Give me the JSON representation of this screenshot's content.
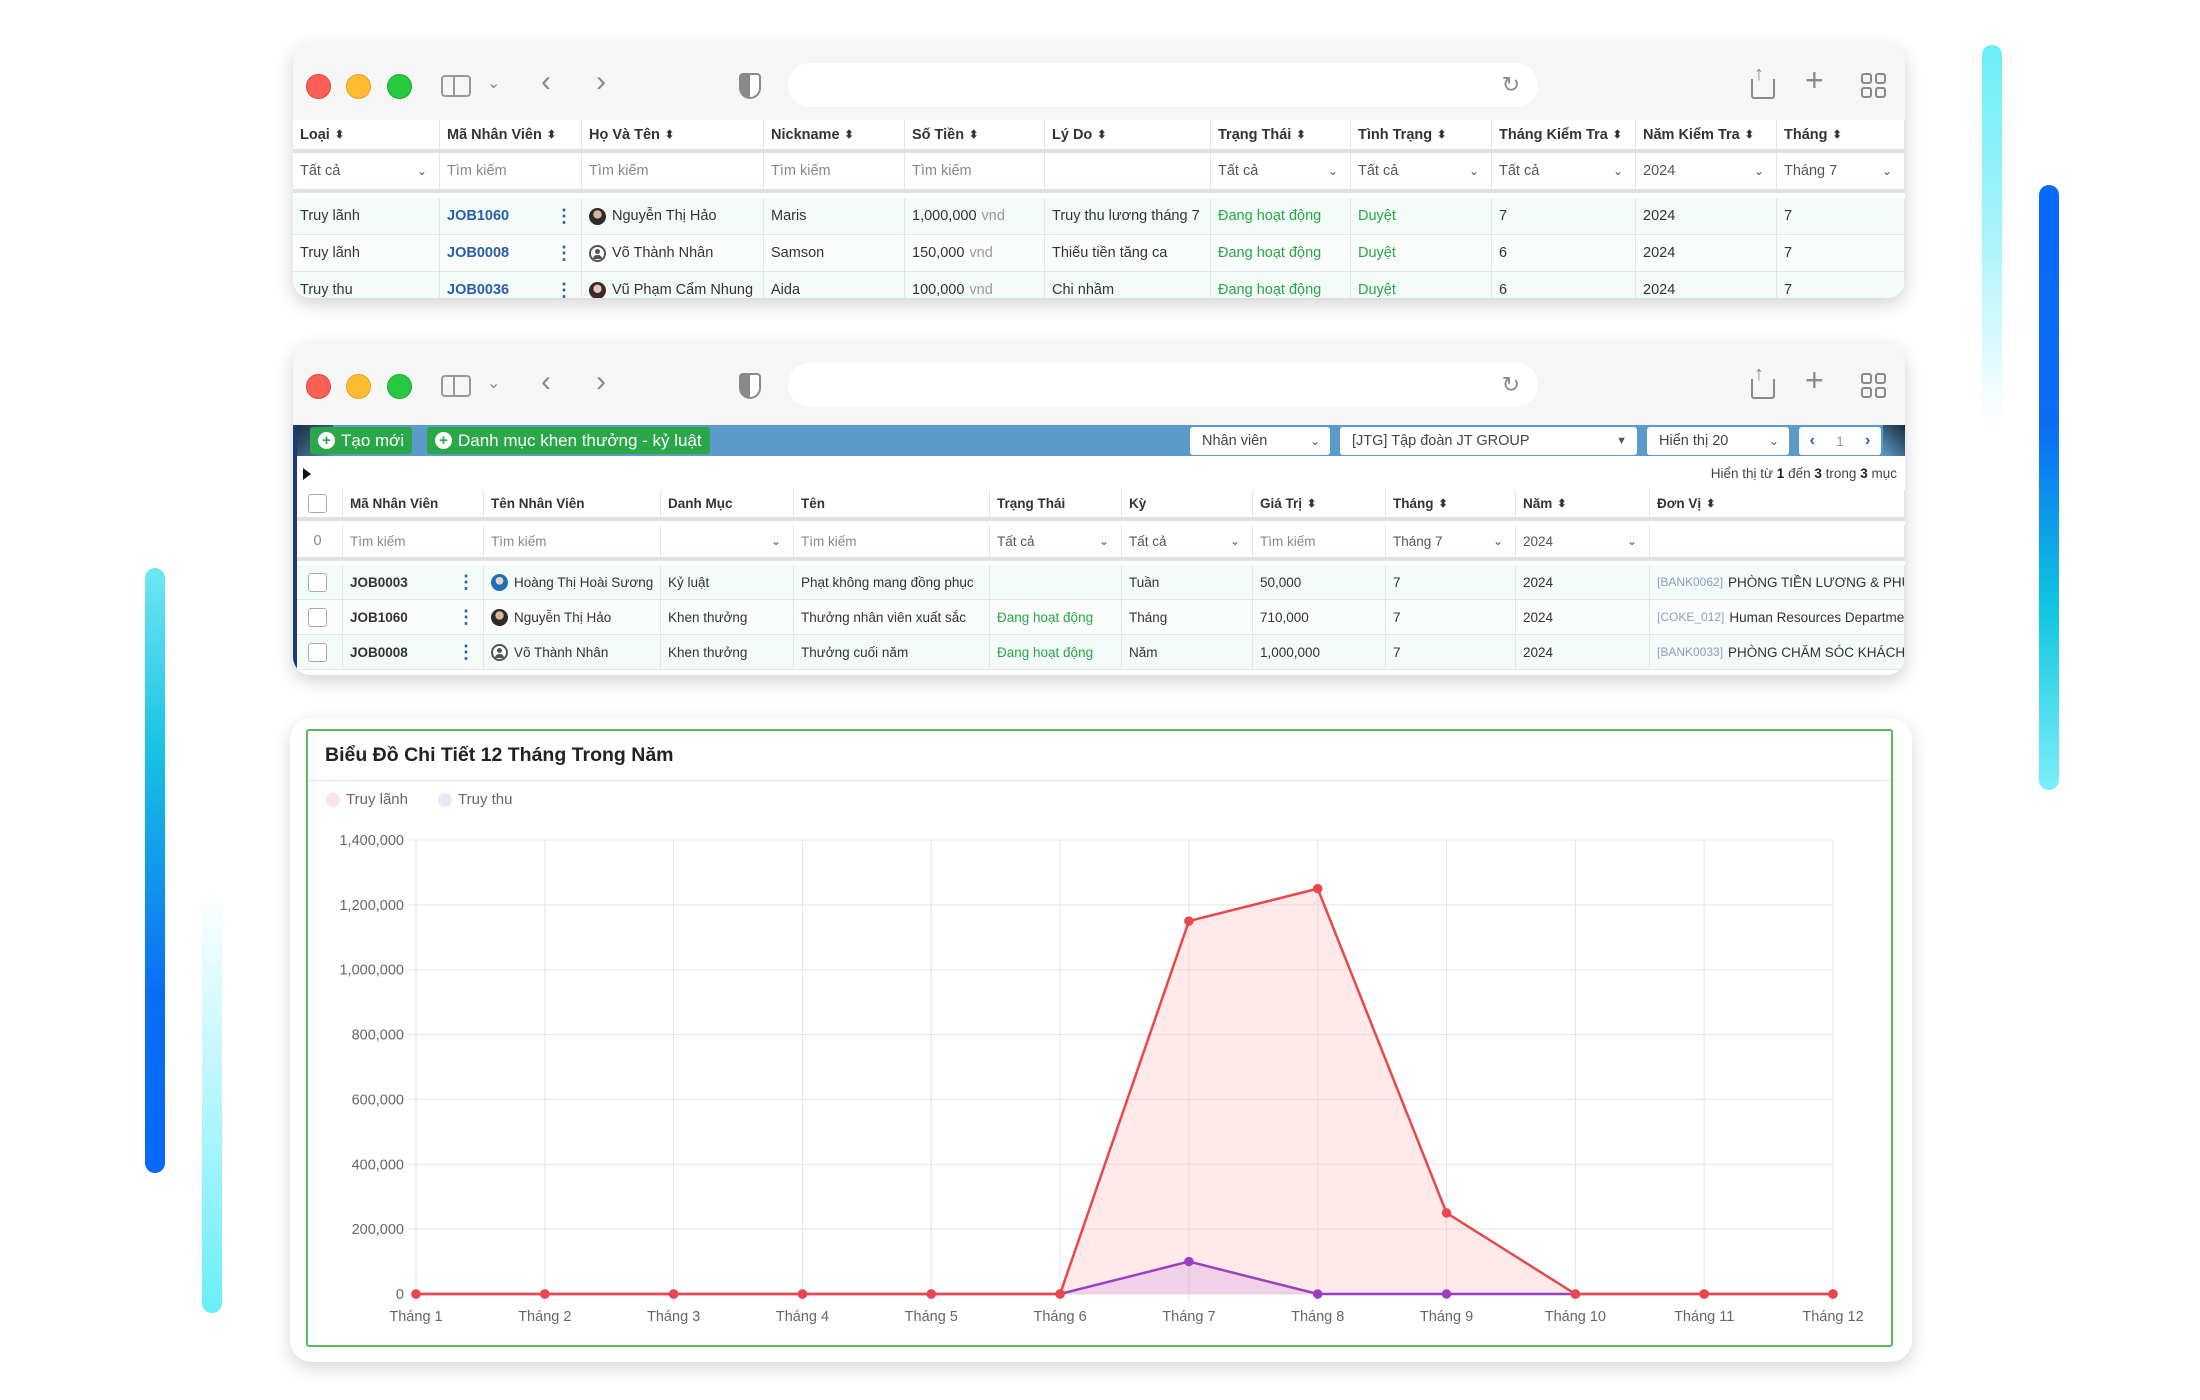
{
  "window1": {
    "columns": [
      {
        "label": "Loại",
        "sortable": true
      },
      {
        "label": "Mã Nhân Viên",
        "sortable": true
      },
      {
        "label": "Họ Và Tên",
        "sortable": true
      },
      {
        "label": "Nickname",
        "sortable": true
      },
      {
        "label": "Số Tiền",
        "sortable": true
      },
      {
        "label": "Lý Do",
        "sortable": true
      },
      {
        "label": "Trạng Thái",
        "sortable": true
      },
      {
        "label": "Tình Trạng",
        "sortable": true
      },
      {
        "label": "Tháng Kiểm Tra",
        "sortable": true
      },
      {
        "label": "Năm Kiểm Tra",
        "sortable": true
      },
      {
        "label": "Tháng",
        "sortable": true
      }
    ],
    "filters": [
      "Tất cả",
      "Tìm kiếm",
      "Tìm kiếm",
      "Tìm kiếm",
      "Tìm kiếm",
      "",
      "Tất cả",
      "Tất cả",
      "Tất cả",
      "2024",
      "Tháng 7"
    ],
    "rows": [
      {
        "type": "Truy lãnh",
        "code": "JOB1060",
        "name": "Nguyễn Thị Hảo",
        "avatar": "photo",
        "nickname": "Maris",
        "amount": "1,000,000",
        "unit": "vnd",
        "reason": "Truy thu lương tháng 7",
        "status": "Đang hoạt động",
        "state": "Duyệt",
        "check_month": "7",
        "check_year": "2024",
        "month": "7"
      },
      {
        "type": "Truy lãnh",
        "code": "JOB0008",
        "name": "Võ Thành Nhân",
        "avatar": "default",
        "nickname": "Samson",
        "amount": "150,000",
        "unit": "vnd",
        "reason": "Thiếu tiền tăng ca",
        "status": "Đang hoạt động",
        "state": "Duyệt",
        "check_month": "6",
        "check_year": "2024",
        "month": "7"
      },
      {
        "type": "Truy thu",
        "code": "JOB0036",
        "name": "Vũ Phạm Cẩm Nhung",
        "avatar": "photo2",
        "nickname": "Aida",
        "amount": "100,000",
        "unit": "vnd",
        "reason": "Chi nhầm",
        "status": "Đang hoạt động",
        "state": "Duyệt",
        "check_month": "6",
        "check_year": "2024",
        "month": "7"
      }
    ]
  },
  "window2": {
    "toolbar": {
      "create_label": "Tạo mới",
      "category_label": "Danh mục khen thưởng - kỷ luật",
      "scope_select": "Nhân viên",
      "company_select": "[JTG] Tập đoàn JT GROUP",
      "page_size_select": "Hiển thị 20",
      "current_page": "1"
    },
    "info": {
      "prefix": "Hiển thị từ",
      "from": "1",
      "to_word": "đến",
      "to": "3",
      "of_word": "trong",
      "total": "3",
      "suffix": "mục"
    },
    "columns": [
      {
        "label": "Mã Nhân Viên",
        "sortable": false
      },
      {
        "label": "Tên Nhân Viên",
        "sortable": false
      },
      {
        "label": "Danh Mục",
        "sortable": false
      },
      {
        "label": "Tên",
        "sortable": false
      },
      {
        "label": "Trạng Thái",
        "sortable": false
      },
      {
        "label": "Kỳ",
        "sortable": false
      },
      {
        "label": "Giá Trị",
        "sortable": true
      },
      {
        "label": "Tháng",
        "sortable": true
      },
      {
        "label": "Năm",
        "sortable": true
      },
      {
        "label": "Đơn Vị",
        "sortable": true
      }
    ],
    "filters": {
      "selected_count": "0",
      "values": [
        "Tìm kiếm",
        "Tìm kiếm",
        "",
        "Tìm kiếm",
        "Tất cả",
        "Tất cả",
        "Tìm kiếm",
        "Tháng 7",
        "2024",
        ""
      ]
    },
    "rows": [
      {
        "code": "JOB0003",
        "name": "Hoàng Thị Hoài Sương",
        "avatar": "blue",
        "category": "Kỷ luật",
        "title": "Phạt không mang đồng phục",
        "status": "",
        "period": "Tuần",
        "value": "50,000",
        "month": "7",
        "year": "2024",
        "unit_code": "[BANK0062]",
        "unit_name": "PHÒNG TIỀN LƯƠNG & PHÚC"
      },
      {
        "code": "JOB1060",
        "name": "Nguyễn Thị Hảo",
        "avatar": "photo",
        "category": "Khen thưởng",
        "title": "Thưởng nhân viên xuất sắc",
        "status": "Đang hoạt động",
        "period": "Tháng",
        "value": "710,000",
        "month": "7",
        "year": "2024",
        "unit_code": "[COKE_012]",
        "unit_name": "Human Resources Departmen"
      },
      {
        "code": "JOB0008",
        "name": "Võ Thành Nhân",
        "avatar": "default",
        "category": "Khen thưởng",
        "title": "Thưởng cuối năm",
        "status": "Đang hoạt động",
        "period": "Năm",
        "value": "1,000,000",
        "month": "7",
        "year": "2024",
        "unit_code": "[BANK0033]",
        "unit_name": "PHÒNG CHĂM SÓC KHÁCH H"
      }
    ]
  },
  "chart_data": {
    "type": "line",
    "title": "Biểu Đồ Chi Tiết 12 Tháng Trong Năm",
    "categories": [
      "Tháng 1",
      "Tháng 2",
      "Tháng 3",
      "Tháng 4",
      "Tháng 5",
      "Tháng 6",
      "Tháng 7",
      "Tháng 8",
      "Tháng 9",
      "Tháng 10",
      "Tháng 11",
      "Tháng 12"
    ],
    "series": [
      {
        "name": "Truy lãnh",
        "color": "#e8474c",
        "fill": "rgba(255,182,182,0.3)",
        "legend_color": "#fde4e4",
        "values": [
          0,
          0,
          0,
          0,
          0,
          0,
          1150000,
          1250000,
          250000,
          0,
          0,
          0
        ]
      },
      {
        "name": "Truy thu",
        "color": "#9b3fbf",
        "fill": "rgba(200,140,220,0.25)",
        "legend_color": "#efe6f5",
        "values": [
          0,
          0,
          0,
          0,
          0,
          0,
          100000,
          0,
          0,
          0,
          0,
          0
        ]
      }
    ],
    "yticks": [
      "0",
      "200,000",
      "400,000",
      "600,000",
      "800,000",
      "1,000,000",
      "1,200,000",
      "1,400,000"
    ],
    "ylim": [
      0,
      1400000
    ],
    "xlabel": "",
    "ylabel": "",
    "grid": true,
    "legend_position": "top-left"
  }
}
